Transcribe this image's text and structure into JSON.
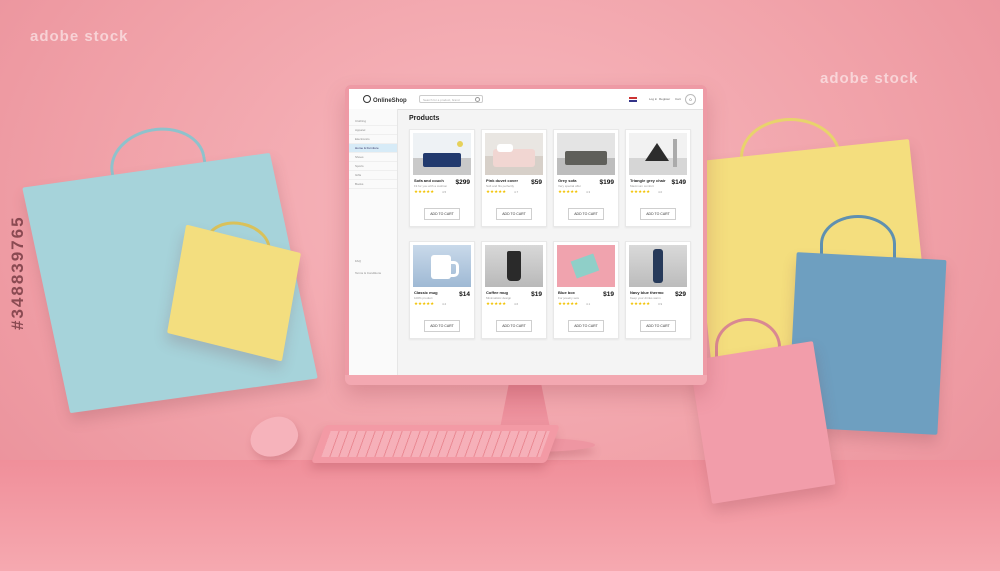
{
  "scene": {
    "watermark": "adobe stock",
    "stock_id": "#348839765"
  },
  "shop": {
    "logo": "OnlineShop",
    "search_placeholder": "Search for a product, brand",
    "login": "Log in",
    "register": "Register",
    "cart_label": "Cart",
    "cart_count": "0",
    "products_title": "Products",
    "sidebar": [
      {
        "label": "Clothing"
      },
      {
        "label": "Apparel"
      },
      {
        "label": "Electronics"
      },
      {
        "label": "Home & Furniture"
      },
      {
        "label": "Shoes"
      },
      {
        "label": "Sports"
      },
      {
        "label": "Gifts"
      },
      {
        "label": "Books"
      }
    ],
    "sidebar_bottom": [
      {
        "label": "FAQ"
      },
      {
        "label": "Terms & Conditions"
      }
    ],
    "button_label": "ADD TO CART",
    "products": [
      {
        "name": "Sofa and couch",
        "desc": "Fit for you with a cushion",
        "price": "$299",
        "stars": "★★★★★",
        "rating": "4.5",
        "image": "sofa"
      },
      {
        "name": "Pink duvet cover",
        "desc": "Soft and fits perfectly",
        "price": "$59",
        "stars": "★★★★★",
        "rating": "4.7",
        "image": "bed"
      },
      {
        "name": "Grey sofa",
        "desc": "Very special offer",
        "price": "$199",
        "stars": "★★★★★",
        "rating": "4.3",
        "image": "grey-sofa"
      },
      {
        "name": "Triangle grey chair",
        "desc": "Maximum comfort",
        "price": "$149",
        "stars": "★★★★★",
        "rating": "4.0",
        "image": "chair"
      },
      {
        "name": "Classic mug",
        "desc": "100% product",
        "price": "$14",
        "stars": "★★★★★",
        "rating": "4.2",
        "image": "mug"
      },
      {
        "name": "Coffee mug",
        "desc": "Minimalistic design",
        "price": "$19",
        "stars": "★★★★★",
        "rating": "4.6",
        "image": "coffee-mug"
      },
      {
        "name": "Blue box",
        "desc": "For jewelry sets",
        "price": "$19",
        "stars": "★★★★★",
        "rating": "4.1",
        "image": "box"
      },
      {
        "name": "Navy blue thermo",
        "desc": "Keep your drinks warm",
        "price": "$29",
        "stars": "★★★★★",
        "rating": "3.9",
        "image": "thermo"
      }
    ]
  },
  "colors": {
    "background": "#f2a6ad",
    "monitor": "#ee9aa5",
    "bag_light_blue": "#9fd0d6",
    "bag_yellow": "#f3de7f",
    "bag_blue": "#6d9fc0",
    "bag_pink": "#f09aa8",
    "star": "#f2c200"
  }
}
